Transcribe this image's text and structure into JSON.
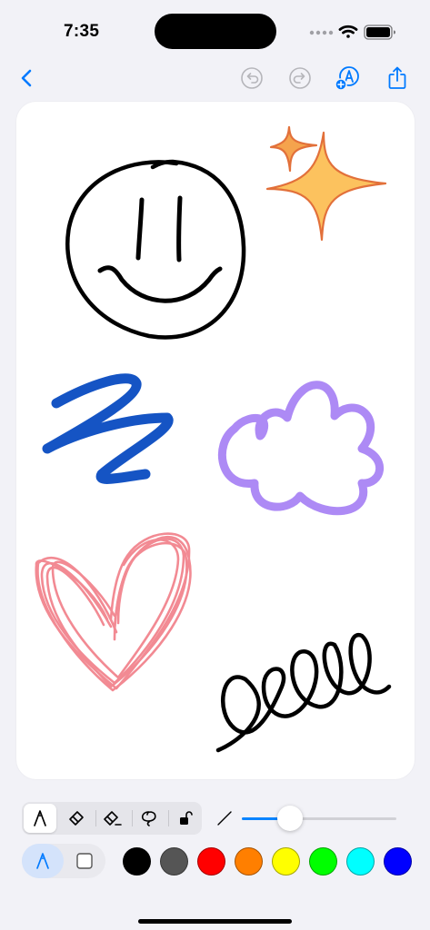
{
  "status_bar": {
    "time": "7:35",
    "icons": [
      "signal-icon",
      "wifi-icon",
      "battery-icon"
    ]
  },
  "nav": {
    "buttons": [
      "back-icon",
      "undo-icon",
      "redo-icon",
      "markup-icon",
      "share-icon"
    ],
    "accent": "#007aff",
    "disabled": "#b5b5ba"
  },
  "canvas": {
    "drawings": [
      "smiley-face",
      "sparkles",
      "blue-scribble",
      "purple-cloud",
      "pink-heart",
      "black-loops"
    ],
    "colors": {
      "smiley": "#000000",
      "sparkle_fill": "#fcc25e",
      "sparkle_stroke": "#e2703a",
      "scribble": "#1554c4",
      "cloud": "#ad8af5",
      "heart": "#f28a93",
      "loops": "#000000"
    }
  },
  "toolbar": {
    "tools": [
      "pen-tool",
      "eraser-tool",
      "pixel-eraser-tool",
      "lasso-tool",
      "lock-tool"
    ],
    "selected_tool": "pen-tool",
    "stroke_width_fraction": 0.31,
    "modes": [
      "pen-mode",
      "shape-mode"
    ],
    "selected_mode": "pen-mode",
    "palette": [
      {
        "name": "black",
        "hex": "#000000"
      },
      {
        "name": "gray",
        "hex": "#555555"
      },
      {
        "name": "red",
        "hex": "#ff0000"
      },
      {
        "name": "orange",
        "hex": "#ff7f00"
      },
      {
        "name": "yellow",
        "hex": "#ffff00"
      },
      {
        "name": "green",
        "hex": "#00ff00"
      },
      {
        "name": "cyan",
        "hex": "#00ffff"
      },
      {
        "name": "blue",
        "hex": "#0000ff"
      }
    ]
  }
}
